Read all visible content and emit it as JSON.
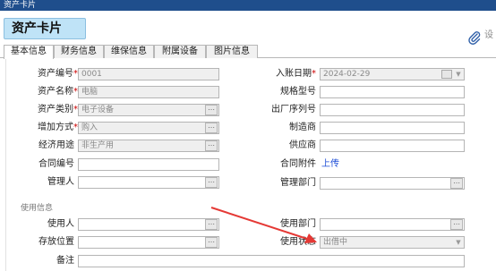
{
  "window": {
    "title": "资产卡片"
  },
  "header": {
    "card_title": "资产卡片",
    "edge_text": "设"
  },
  "tabs": [
    {
      "label": "基本信息",
      "active": true
    },
    {
      "label": "财务信息",
      "active": false
    },
    {
      "label": "维保信息",
      "active": false
    },
    {
      "label": "附属设备",
      "active": false
    },
    {
      "label": "图片信息",
      "active": false
    }
  ],
  "form": {
    "asset_no": {
      "label": "资产编号",
      "required_mark": "*",
      "value": "0001"
    },
    "entry_date": {
      "label": "入账日期",
      "required_mark": "*",
      "value": "2024-02-29"
    },
    "asset_name": {
      "label": "资产名称",
      "required_mark": "*",
      "value": "电脑"
    },
    "spec_model": {
      "label": "规格型号",
      "value": ""
    },
    "asset_category": {
      "label": "资产类别",
      "required_mark": "*",
      "value": "电子设备",
      "button": "⋯"
    },
    "serial_no": {
      "label": "出厂序列号",
      "value": ""
    },
    "add_method": {
      "label": "增加方式",
      "required_mark": "*",
      "value": "购入",
      "button": "⋯"
    },
    "manufacturer": {
      "label": "制造商",
      "value": ""
    },
    "econ_use": {
      "label": "经济用途",
      "value": "非生产用",
      "button": "⋯"
    },
    "supplier": {
      "label": "供应商",
      "value": ""
    },
    "contract_no": {
      "label": "合同编号",
      "value": ""
    },
    "contract_attachment": {
      "label": "合同附件",
      "link": "上传"
    },
    "manager": {
      "label": "管理人",
      "value": "",
      "button": "⋯"
    },
    "manager_dept": {
      "label": "管理部门",
      "value": "",
      "button": "⋯"
    },
    "usage_section": "使用信息",
    "user": {
      "label": "使用人",
      "value": "",
      "button": "⋯"
    },
    "use_dept": {
      "label": "使用部门",
      "value": "",
      "button": "⋯"
    },
    "storage": {
      "label": "存放位置",
      "value": "",
      "button": "⋯"
    },
    "use_status": {
      "label": "使用状态",
      "value": "出借中"
    },
    "remark": {
      "label": "备注",
      "value": ""
    }
  },
  "colors": {
    "title_bg": "#1f4e8c",
    "card_title_bg": "#bfe3f7",
    "required": "#cc0000",
    "link": "#1a4bd6",
    "annotation_arrow": "#e53935"
  },
  "icons": {
    "attachment": "paperclip-icon",
    "date_picker": "calendar-icon",
    "dropdown": "chevron-down-icon",
    "lookup": "ellipsis-icon"
  }
}
